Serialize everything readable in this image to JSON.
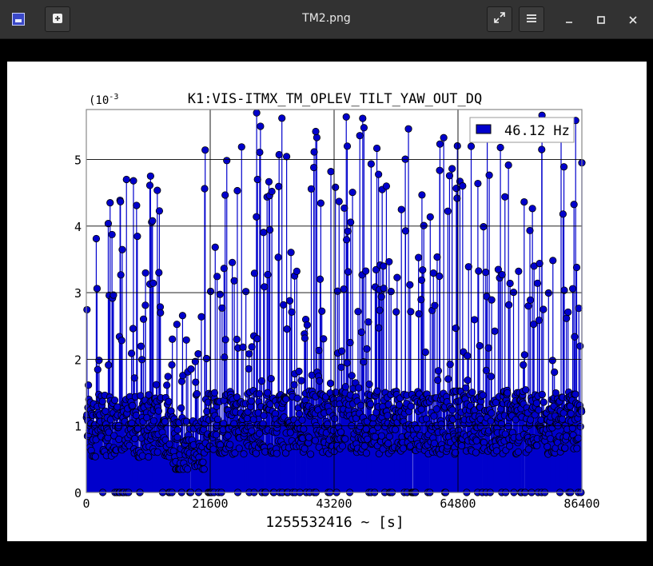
{
  "window": {
    "title": "TM2.png",
    "new_tab_icon": "plus-icon",
    "fullscreen_icon": "expand-icon",
    "menu_icon": "hamburger-icon",
    "minimize_icon": "minimize-icon",
    "maximize_icon": "maximize-icon",
    "close_icon": "close-icon"
  },
  "colors": {
    "series": "#0000cc",
    "marker_fill": "#0000cc",
    "marker_edge": "#000000",
    "grid": "#000000",
    "background": "#ffffff"
  },
  "chart_data": {
    "type": "scatter",
    "style": "stem",
    "title": "K1:VIS-ITMX_TM_OPLEV_TILT_YAW_OUT_DQ",
    "xlabel": "1255532416 ~ [s]",
    "ylabel": "",
    "y_multiplier_label": "(10",
    "y_multiplier_exp": "-3",
    "xlim": [
      0,
      86400
    ],
    "ylim": [
      0,
      5.75
    ],
    "xticks": [
      0,
      21600,
      43200,
      64800,
      86400
    ],
    "xtick_labels": [
      "0",
      "21600",
      "43200",
      "64800",
      "86400"
    ],
    "yticks": [
      0,
      1,
      2,
      3,
      4,
      5
    ],
    "ytick_labels": [
      "0",
      "1",
      "2",
      "3",
      "4",
      "5"
    ],
    "grid": true,
    "legend_position": "top-right",
    "series": [
      {
        "name": "46.12 Hz",
        "segments": [
          {
            "x_start": 0,
            "x_end": 15100,
            "baseline_mean": 1.0,
            "peak_min": 2.9,
            "peak_max": 4.75
          },
          {
            "x_start": 15100,
            "x_end": 20600,
            "baseline_mean": 0.65,
            "peak_min": 1.6,
            "peak_max": 2.7
          },
          {
            "x_start": 20600,
            "x_end": 86400,
            "baseline_mean": 1.05,
            "peak_min": 3.0,
            "peak_max": 5.7
          }
        ],
        "highlight_points": [
          {
            "x": 29700,
            "y": 5.7
          },
          {
            "x": 34100,
            "y": 5.62
          },
          {
            "x": 40000,
            "y": 5.42
          },
          {
            "x": 45500,
            "y": 5.2
          },
          {
            "x": 72200,
            "y": 5.18
          },
          {
            "x": 79400,
            "y": 5.15
          },
          {
            "x": 86400,
            "y": 4.95
          },
          {
            "x": 11200,
            "y": 4.75
          },
          {
            "x": 7000,
            "y": 4.7
          }
        ]
      }
    ]
  }
}
